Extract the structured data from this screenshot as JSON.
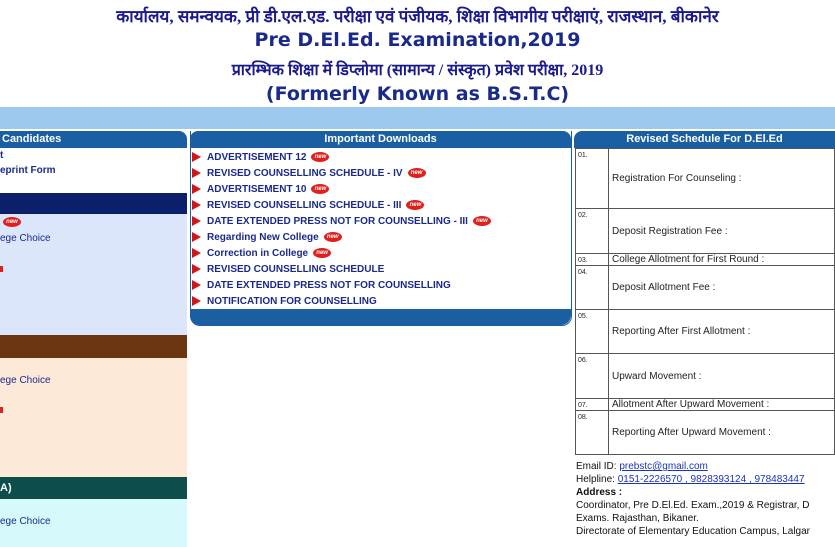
{
  "header": {
    "hindi_title": "कार्यालय, समन्वयक, प्री डी.एल.एड. परीक्षा एवं पंजीयक, शिक्षा विभागीय परीक्षाएं, राजस्थान, बीकानेर",
    "english_title": "Pre D.El.Ed. Examination,2019",
    "hindi_subtitle": "प्रारम्भिक शिक्षा में डिप्लोमा (सामान्य / संस्कृत) प्रवेश परीक्षा, 2019",
    "formerly": "(Formerly Known as B.S.T.C)"
  },
  "left_panel": {
    "head": "Candidates",
    "items": [
      "t",
      "eprint Form"
    ],
    "band1_items": [
      "ege Choice"
    ],
    "band2_items": [
      "ege Choice"
    ],
    "band3_label": "A)",
    "band3_items": [
      "ege Choice"
    ],
    "new_label": "new"
  },
  "downloads": {
    "head": "Important Downloads",
    "items": [
      {
        "label": "ADVERTISEMENT 12",
        "new": true
      },
      {
        "label": "REVISED COUNSELLING SCHEDULE - IV",
        "new": true
      },
      {
        "label": "ADVERTISEMENT 10",
        "new": true
      },
      {
        "label": "REVISED COUNSELLING SCHEDULE - III",
        "new": true
      },
      {
        "label": "DATE EXTENDED PRESS NOT FOR COUNSELLING - III",
        "new": true
      },
      {
        "label": "Regarding New College",
        "new": true
      },
      {
        "label": "Correction in College",
        "new": true
      },
      {
        "label": "REVISED COUNSELLING SCHEDULE",
        "new": false
      },
      {
        "label": "DATE EXTENDED PRESS NOT FOR COUNSELLING",
        "new": false
      },
      {
        "label": "NOTIFICATION FOR COUNSELLING",
        "new": false
      }
    ],
    "new_label": "new"
  },
  "schedule": {
    "head": "Revised Schedule For D.El.Ed",
    "rows": [
      {
        "no": "01.",
        "label": "Registration For Counseling :"
      },
      {
        "no": "02.",
        "label": "Deposit Registration Fee :"
      },
      {
        "no": "03.",
        "label": "College Allotment for First Round :"
      },
      {
        "no": "04.",
        "label": "Deposit Allotment Fee :"
      },
      {
        "no": "05.",
        "label": "Reporting After First Allotment :"
      },
      {
        "no": "06.",
        "label": "Upward Movement :"
      },
      {
        "no": "07.",
        "label": "Allotment After Upward Movement :"
      },
      {
        "no": "08.",
        "label": "Reporting After Upward Movement :"
      }
    ]
  },
  "contact": {
    "email_label": "Email ID: ",
    "email": "prebstc@gmail.com",
    "helpline_label": "Helpline: ",
    "helpline": "0151-2226570 , 9828393124 , 978483447",
    "address_label": "Address :",
    "address_line1": "Coordinator, Pre D.El.Ed. Exam.,2019 & Registrar, D",
    "address_line2": "Exams. Rajasthan, Bikaner.",
    "address_line3": "Directorate of Elementary Education Campus, Lalgar"
  },
  "colors": {
    "header_blue": "#1b5fa3",
    "light_bar": "#9dc9ee",
    "band_navy": "#0b1f6b",
    "band_brown": "#6b3510",
    "band_teal": "#0d4d4a",
    "panel_blue_bg": "#dce6fb",
    "panel_peach_bg": "#fde9d8",
    "panel_cyan_bg": "#d6fafb",
    "new_badge": "#e0201c"
  }
}
